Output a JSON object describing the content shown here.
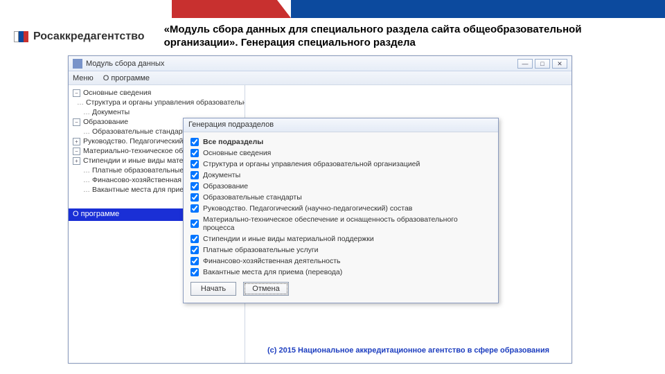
{
  "banner": {},
  "brand": {
    "name": "Росаккредагентство"
  },
  "slide": {
    "title": "«Модуль сбора данных для специального раздела сайта общеобразовательной организации». Генерация специального раздела"
  },
  "app": {
    "title": "Модуль сбора данных",
    "win_min": "—",
    "win_max": "□",
    "win_close": "✕",
    "menu": {
      "file": "Меню",
      "about": "О программе"
    },
    "tree": {
      "n0": "Основные сведения",
      "n1": "Структура и органы управления образовательной организацией",
      "n2": "Документы",
      "n3": "Образование",
      "n4": "Образовательные стандарты",
      "n5": "Руководство. Педагогический",
      "n6": "Материально-техническое обе",
      "n7": "Стипендии и иные виды матер",
      "n8": "Платные образовательные усл",
      "n9": "Финансово-хозяйственная дея",
      "n10": "Вакантные места для приема"
    },
    "about_bar": "О программе",
    "copyright": "(c) 2015 Национальное аккредитационное агентство в сфере образования"
  },
  "dialog": {
    "title": "Генерация подразделов",
    "opt_all": "Все подразделы",
    "opt0": "Основные сведения",
    "opt1": "Структура и органы управления образовательной организацией",
    "opt2": "Документы",
    "opt3": "Образование",
    "opt4": "Образовательные стандарты",
    "opt5": "Руководство. Педагогический (научно-педагогический) состав",
    "opt6": "Материально-техническое обеспечение и оснащенность образовательного процесса",
    "opt7": "Стипендии и иные виды материальной поддержки",
    "opt8": "Платные образовательные услуги",
    "opt9": "Финансово-хозяйственная деятельность",
    "opt10": "Вакантные места для приема (перевода)",
    "start": "Начать",
    "cancel": "Отмена"
  }
}
